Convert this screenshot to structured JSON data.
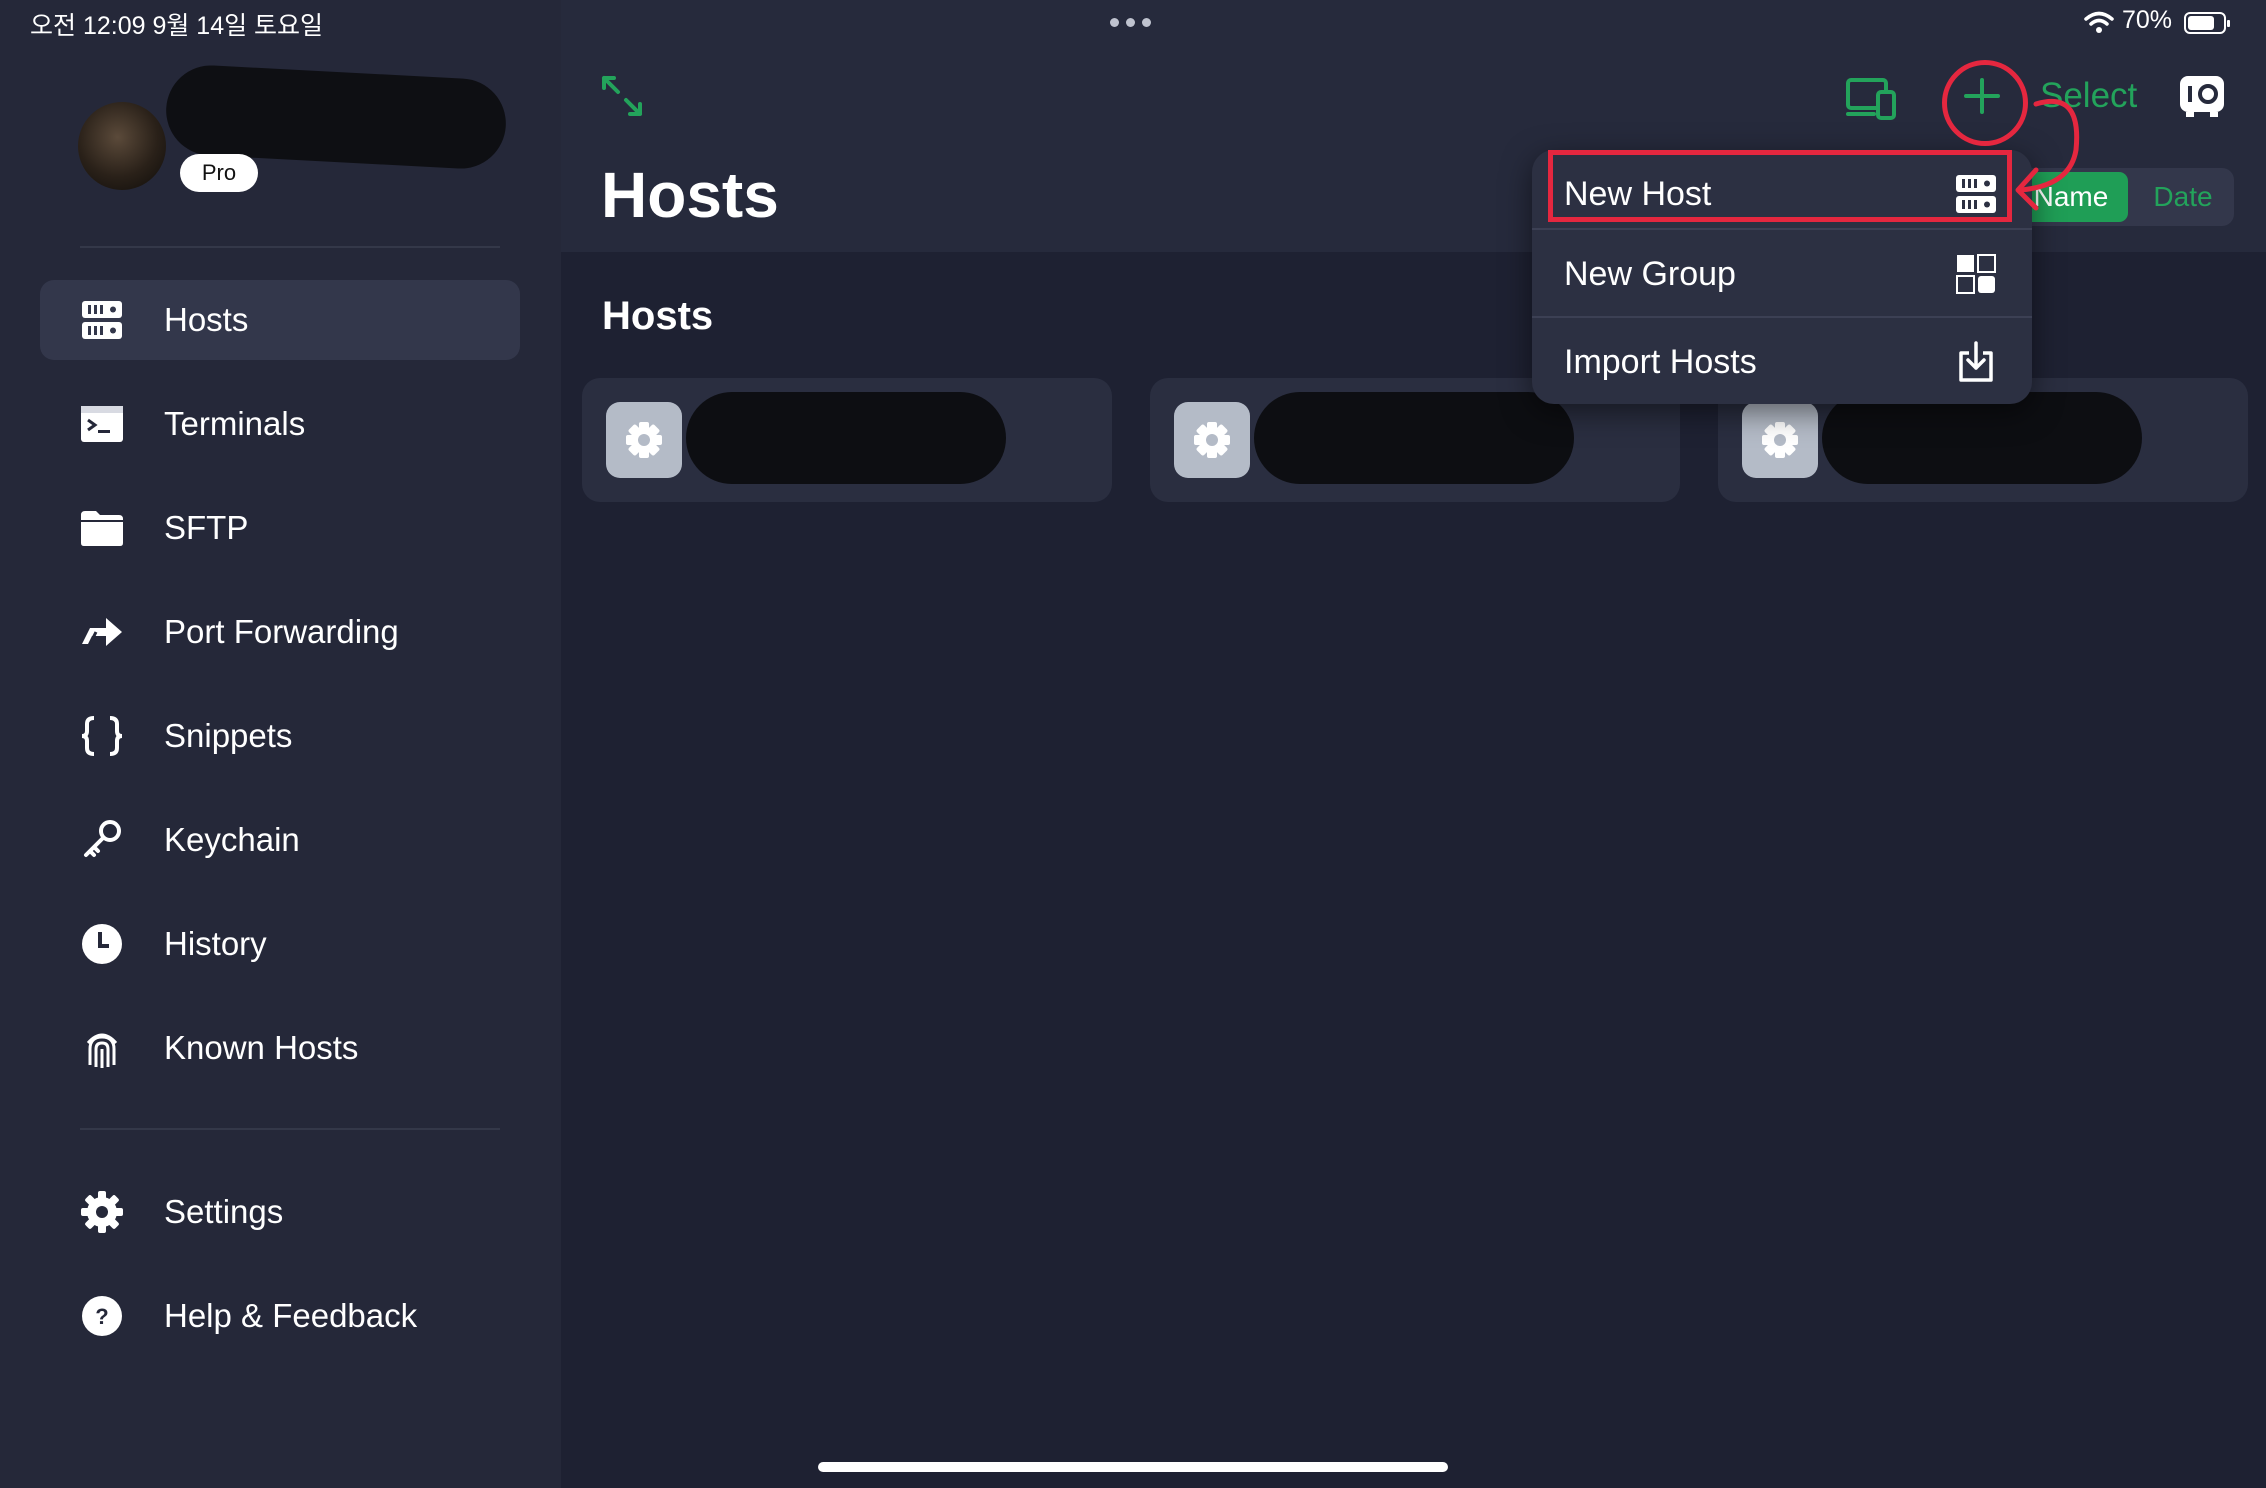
{
  "status_bar": {
    "time": "오전 12:09   9월 14일 토요일",
    "battery": "70%"
  },
  "sidebar": {
    "profile": {
      "badge": "Pro"
    },
    "items": [
      {
        "label": "Hosts",
        "icon": "server-icon",
        "active": true
      },
      {
        "label": "Terminals",
        "icon": "terminal-icon"
      },
      {
        "label": "SFTP",
        "icon": "folder-icon"
      },
      {
        "label": "Port Forwarding",
        "icon": "forward-arrow-icon"
      },
      {
        "label": "Snippets",
        "icon": "braces-icon"
      },
      {
        "label": "Keychain",
        "icon": "key-icon"
      },
      {
        "label": "History",
        "icon": "clock-icon"
      },
      {
        "label": "Known Hosts",
        "icon": "fingerprint-icon"
      }
    ],
    "footer_items": [
      {
        "label": "Settings",
        "icon": "gear-icon"
      },
      {
        "label": "Help & Feedback",
        "icon": "question-icon"
      }
    ]
  },
  "header": {
    "title": "Hosts",
    "select_label": "Select",
    "sort": {
      "name": "Name",
      "date": "Date",
      "selected": "Name"
    }
  },
  "content": {
    "section_title": "Hosts",
    "host_count": 3
  },
  "menu": {
    "items": [
      {
        "label": "New Host",
        "icon": "server-icon"
      },
      {
        "label": "New Group",
        "icon": "group-icon"
      },
      {
        "label": "Import Hosts",
        "icon": "import-icon"
      }
    ]
  },
  "colors": {
    "accent": "#23a35b",
    "annotation": "#e5273f",
    "sidebar_bg": "#252839",
    "main_bg": "#1e2132"
  }
}
